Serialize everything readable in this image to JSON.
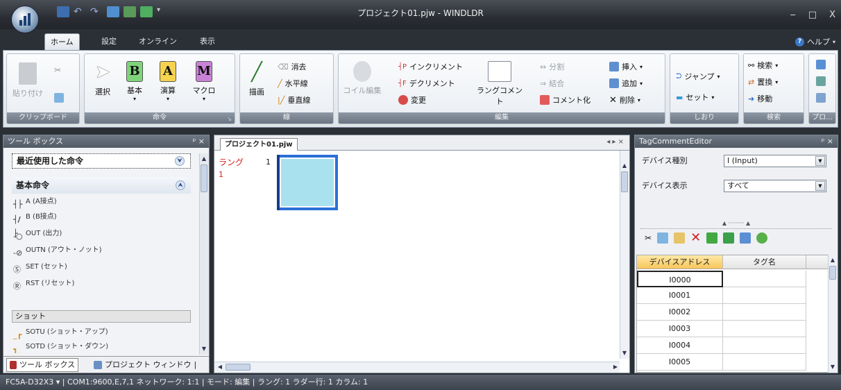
{
  "window": {
    "title": "プロジェクト01.pjw - WINDLDR",
    "min": "‒",
    "max": "□",
    "close": "X"
  },
  "tabs": {
    "home": "ホーム",
    "settings": "設定",
    "online": "オンライン",
    "view": "表示"
  },
  "help": "ヘルプ",
  "ribbon": {
    "clipboard": {
      "label": "クリップボード",
      "paste": "貼り付け"
    },
    "command": {
      "label": "命令",
      "select": "選択",
      "basic": "基本",
      "calc": "演算",
      "macro": "マクロ",
      "letters": {
        "basic": "B",
        "calc": "A",
        "macro": "M"
      }
    },
    "line": {
      "label": "線",
      "draw": "描画",
      "erase": "消去",
      "hline": "水平線",
      "vline": "垂直線"
    },
    "edit": {
      "label": "編集",
      "coil_edit": "コイル編集",
      "increment": "インクリメント",
      "decrement": "デクリメント",
      "change": "変更",
      "rung_comment": "ラングコメント",
      "split": "分割",
      "join": "結合",
      "comment_out": "コメント化",
      "insert": "挿入",
      "add": "追加",
      "delete": "削除"
    },
    "bookmark": {
      "label": "しおり",
      "jump": "ジャンプ",
      "set": "セット"
    },
    "search": {
      "label": "検索",
      "find": "検索",
      "replace": "置換",
      "move": "移動"
    },
    "project": {
      "label": "プロ..."
    }
  },
  "toolbox": {
    "title": "ツール ボックス",
    "pin": "ᵖ ×",
    "recent": "最近使用した命令",
    "basic": "基本命令",
    "items": [
      "A (A接点)",
      "B (B接点)",
      "OUT (出力)",
      "OUTN (アウト・ノット)",
      "SET (セット)",
      "RST (リセット)"
    ],
    "shot": "ショット",
    "shot_items": [
      "SOTU (ショット・アップ)",
      "SOTD (ショット・ダウン)"
    ],
    "tab_toolbox": "ツール ボックス",
    "tab_project": "プロジェクト ウィンドウ"
  },
  "editor": {
    "tab": "プロジェクト01.pjw",
    "nav": "◂ ▸ ×",
    "rung_label": "ラング",
    "rung_num": "1",
    "line_num": "1"
  },
  "tageditor": {
    "title": "TagCommentEditor",
    "pin": "ᵖ ×",
    "device_type_label": "デバイス種別",
    "device_type_value": "I (Input)",
    "device_display_label": "デバイス表示",
    "device_display_value": "すべて",
    "col_address": "デバイスアドレス",
    "col_tag": "タグ名",
    "rows": [
      "I0000",
      "I0001",
      "I0002",
      "I0003",
      "I0004",
      "I0005"
    ]
  },
  "status": {
    "text": "FC5A-D32X3 ▾ | COM1:9600,E,7,1  ネットワーク: 1:1 | モード: 編集 | ラング: 1  ラダー行: 1  カラム: 1"
  },
  "colors": {
    "cursor_fill": "#a9e1ef",
    "cursor_border": "#2b6fd6",
    "rung_red": "#d51d1d"
  }
}
